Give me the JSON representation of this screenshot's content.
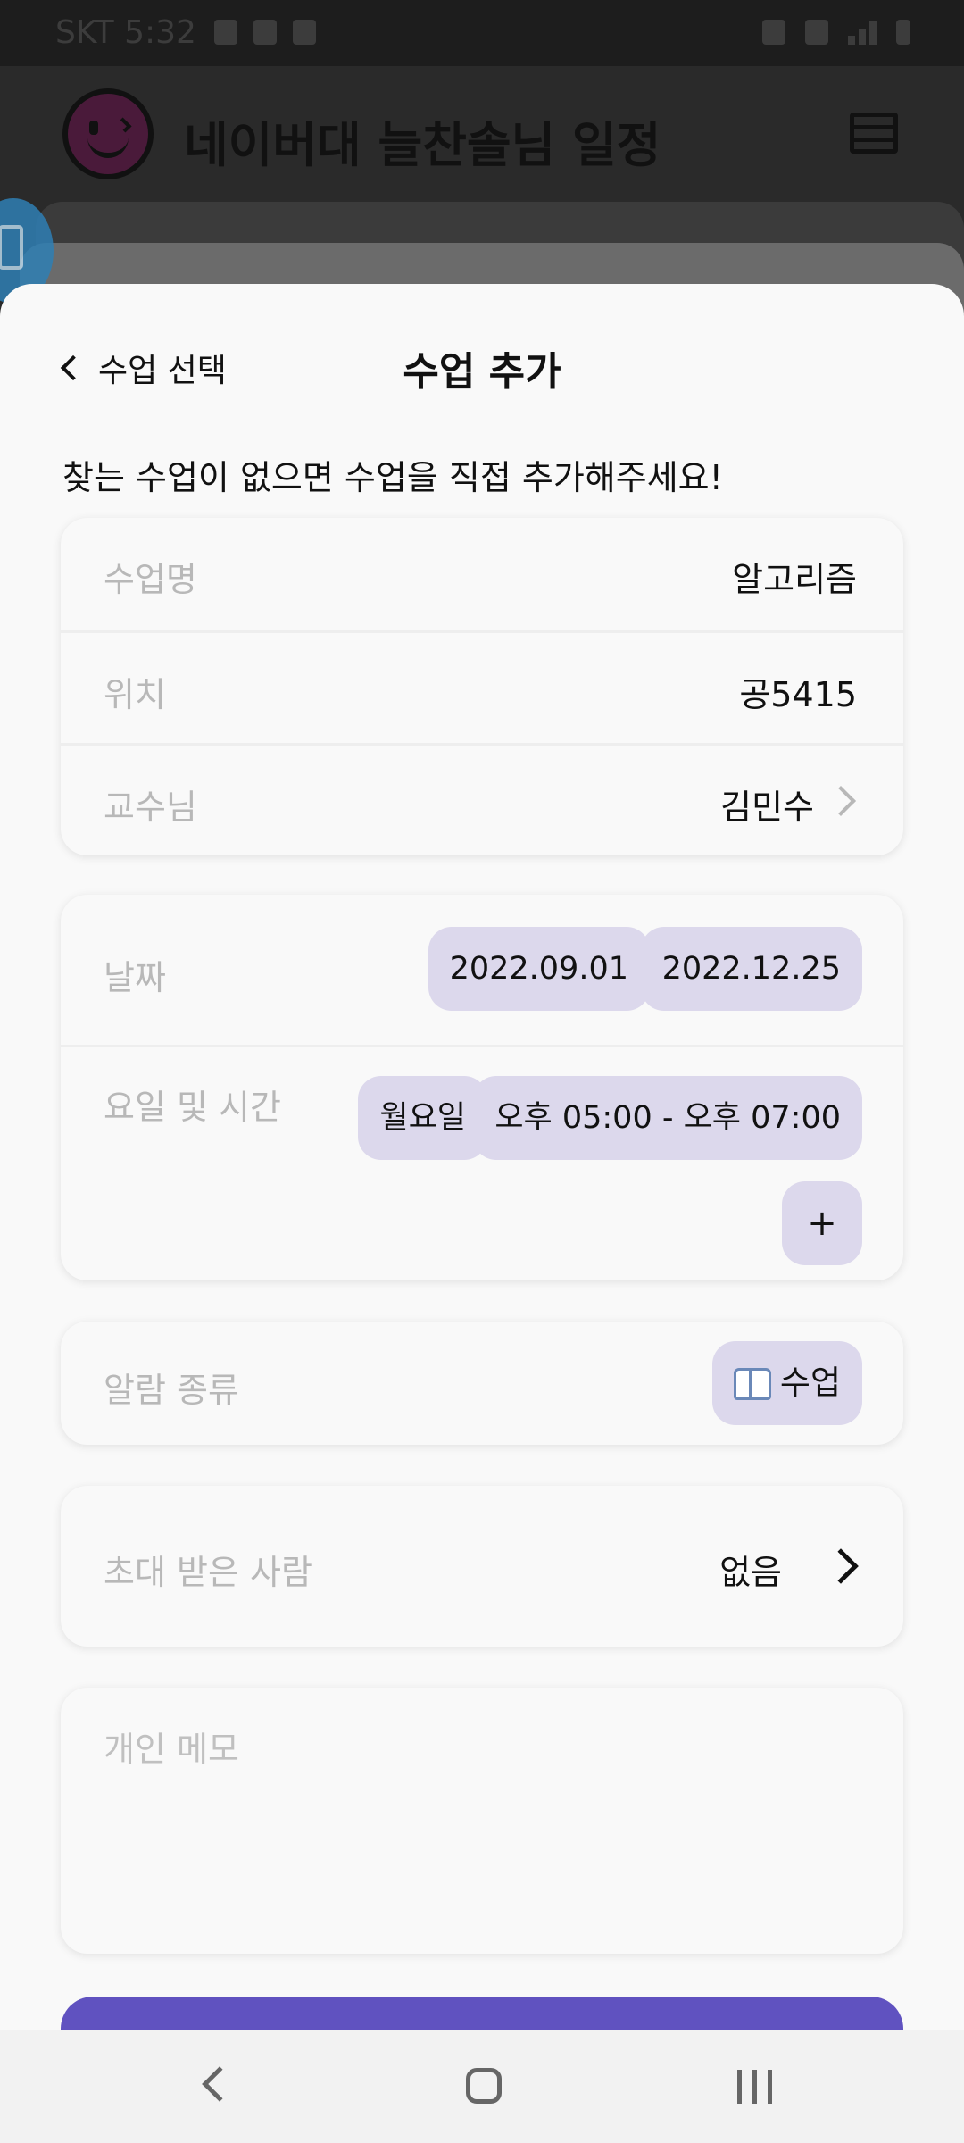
{
  "status_bar": {
    "carrier_time": "SKT 5:32"
  },
  "app_header": {
    "title": "네이버대 늘찬솔님 일정"
  },
  "sheet": {
    "back_label": "수업 선택",
    "title": "수업 추가",
    "hint": "찾는 수업이 없으면 수업을 직접 추가해주세요!"
  },
  "course_info": {
    "name_label": "수업명",
    "name_value": "알고리즘",
    "location_label": "위치",
    "location_value": "공5415",
    "professor_label": "교수님",
    "professor_value": "김민수"
  },
  "schedule": {
    "date_label": "날짜",
    "start_date": "2022.09.01",
    "end_date": "2022.12.25",
    "day_time_label": "요일 및 시간",
    "day": "월요일",
    "time_range": "오후 05:00 - 오후 07:00",
    "add_label": "+"
  },
  "alarm": {
    "label": "알람 종류",
    "value": "수업",
    "icon": "book-icon"
  },
  "invitees": {
    "label": "초대 받은 사람",
    "value": "없음"
  },
  "memo": {
    "placeholder": "개인 메모"
  },
  "colors": {
    "accent": "#6052c0",
    "chip": "#dcd8ec",
    "label_gray": "#b8b8b8"
  }
}
